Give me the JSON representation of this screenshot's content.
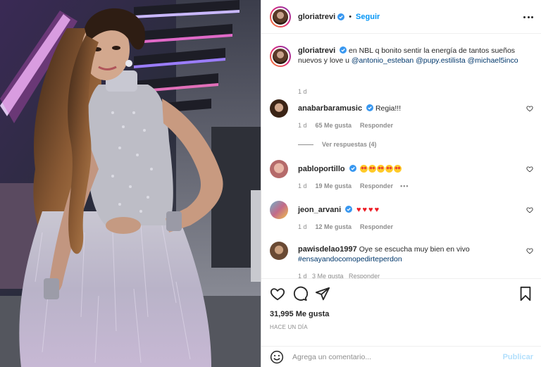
{
  "header": {
    "username": "gloriatrevi",
    "follow_label": "Seguir",
    "separator": "•"
  },
  "caption": {
    "username": "gloriatrevi",
    "text": "en NBL q bonito sentir la energía de tantos sueños nuevos y love u",
    "mentions": [
      "@antonio_esteban",
      "@pupy.estilista",
      "@michael5inco"
    ],
    "time": "1 d"
  },
  "comments": [
    {
      "username": "anabarbaramusic",
      "verified": true,
      "text": "Regia!!!",
      "time": "1 d",
      "likes": "65 Me gusta",
      "reply_label": "Responder",
      "view_replies": "Ver respuestas (4)"
    },
    {
      "username": "pabloportillo",
      "verified": true,
      "emoji": "heart-eyes-face x5",
      "time": "1 d",
      "likes": "19 Me gusta",
      "reply_label": "Responder",
      "more": "•••"
    },
    {
      "username": "jeon_arvani",
      "verified": true,
      "emoji": "red-heart x4",
      "time": "1 d",
      "likes": "12 Me gusta",
      "reply_label": "Responder"
    },
    {
      "username": "pawisdelao1997",
      "verified": false,
      "text": "Oye se escucha muy bien en vivo",
      "hashtag": "#ensayandocomopedirteperdon",
      "meta_partial": "1 d   3 Me gusta   Responder"
    }
  ],
  "actions": {
    "likes_count": "31,995 Me gusta",
    "time_ago": "HACE UN DÍA"
  },
  "add_comment": {
    "placeholder": "Agrega un comentario...",
    "publish_label": "Publicar"
  },
  "icons": {
    "like": "heart-outline-icon",
    "comment": "comment-bubble-icon",
    "share": "paper-plane-icon",
    "save": "bookmark-icon",
    "emoji": "smiley-icon",
    "more": "ellipsis-icon",
    "verified": "verified-badge-icon"
  },
  "colors": {
    "link_blue": "#0095f6",
    "mention_blue": "#00376b",
    "verified_blue": "#3897f0",
    "secondary_text": "#8e8e8e",
    "publish_disabled": "#b2dffc"
  }
}
